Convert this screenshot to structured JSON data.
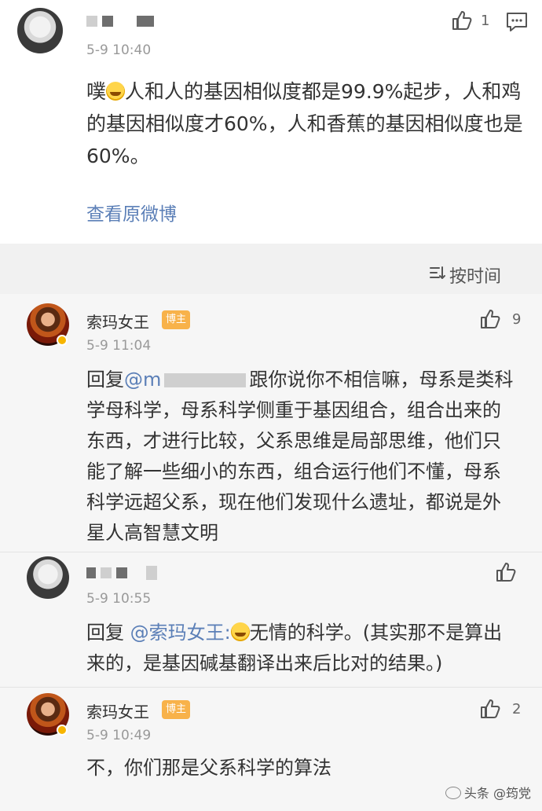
{
  "post": {
    "time": "5-9 10:40",
    "like_count": "1",
    "text_prefix": "噗",
    "text_main": "人和人的基因相似度都是99.9%起步，人和鸡的基因相似度才60%，人和香蕉的基因相似度也是60%。",
    "view_original": "查看原微博"
  },
  "sort": {
    "label": "按时间"
  },
  "comments": [
    {
      "name": "索玛女王",
      "tag": "博主",
      "time": "5-9 11:04",
      "like_count": "9",
      "reply_prefix": "回复",
      "mention": "@m",
      "text": "跟你说你不相信嘛，母系是类科学母科学，母系科学侧重于基因组合，组合出来的东西，才进行比较，父系思维是局部思维，他们只能了解一些细小的东西，组合运行他们不懂，母系科学远超父系，现在他们发现什么遗址，都说是外星人高智慧文明"
    },
    {
      "time": "5-9 10:55",
      "like_count": "",
      "reply_prefix": "回复",
      "mention": "@索玛女王:",
      "text": "无情的科学。(其实那不是算出来的，是基因碱基翻译出来后比对的结果。)"
    },
    {
      "name": "索玛女王",
      "tag": "博主",
      "time": "5-9 10:49",
      "like_count": "2",
      "text": "不，你们那是父系科学的算法"
    }
  ],
  "watermark": {
    "text": "头条 @筠党"
  },
  "colors": {
    "link": "#5b7fb7",
    "tag": "#f8b24a",
    "band": "#f1f1f1",
    "comment_bg": "#f6f6f6"
  },
  "icons": [
    "thumbs-up-icon",
    "comment-icon",
    "sort-icon",
    "verified-icon",
    "laughing-emoji-icon"
  ]
}
